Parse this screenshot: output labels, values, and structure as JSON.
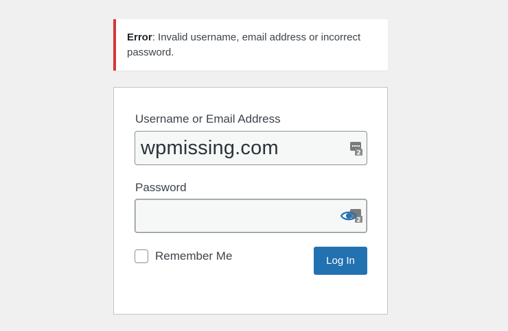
{
  "error": {
    "prefix": "Error",
    "message": ": Invalid username, email address or incorrect password."
  },
  "form": {
    "username_label": "Username or Email Address",
    "username_value": "wpmissing.com",
    "password_label": "Password",
    "password_value": "",
    "remember_label": "Remember Me",
    "remember_checked": false,
    "submit_label": "Log In"
  },
  "icons": {
    "username_field": "password-manager-key-icon",
    "password_field": [
      "show-password-eye-icon",
      "password-manager-key-icon"
    ]
  },
  "colors": {
    "error_accent": "#d63638",
    "primary_button": "#2271b1",
    "eye_icon": "#2271b1"
  }
}
